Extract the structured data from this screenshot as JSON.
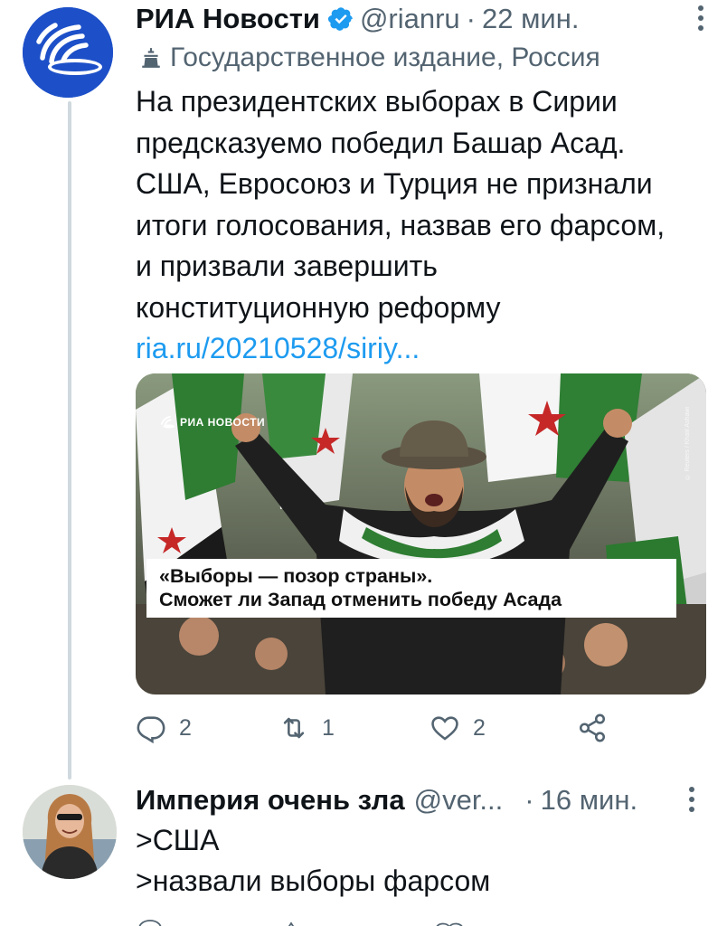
{
  "colors": {
    "accent": "#1d9bf0",
    "muted": "#536471",
    "text": "#0f1419",
    "verified": "#1d9bf0"
  },
  "tweet1": {
    "author": "РИА Новости",
    "handle": "@rianru",
    "separator": "·",
    "time": "22 мин.",
    "label_icon": "state-media-icon",
    "label": "Государственное издание, Россия",
    "text_lines": [
      "На президентских выборах в Сирии",
      "предсказуемо победил Башар Асад.",
      "США, Евросоюз и Турция не признали",
      "итоги голосования, назвав его фарсом,",
      "и призвали завершить",
      "конституционную реформу"
    ],
    "link": "ria.ru/20210528/siriy...",
    "media": {
      "watermark": "РИА НОВОСТИ",
      "caption_lines": [
        "«Выборы — позор страны».",
        "Сможет ли Запад отменить победу Асада"
      ],
      "credit": "© Reuters / Khalil Ashawi"
    },
    "actions": {
      "replies": "2",
      "retweets": "1",
      "likes": "2"
    }
  },
  "tweet2": {
    "author": "Империя очень зла",
    "handle": "@ver...",
    "separator": "·",
    "time": "16 мин.",
    "text_lines": [
      ">США",
      ">назвали выборы фарсом"
    ]
  }
}
